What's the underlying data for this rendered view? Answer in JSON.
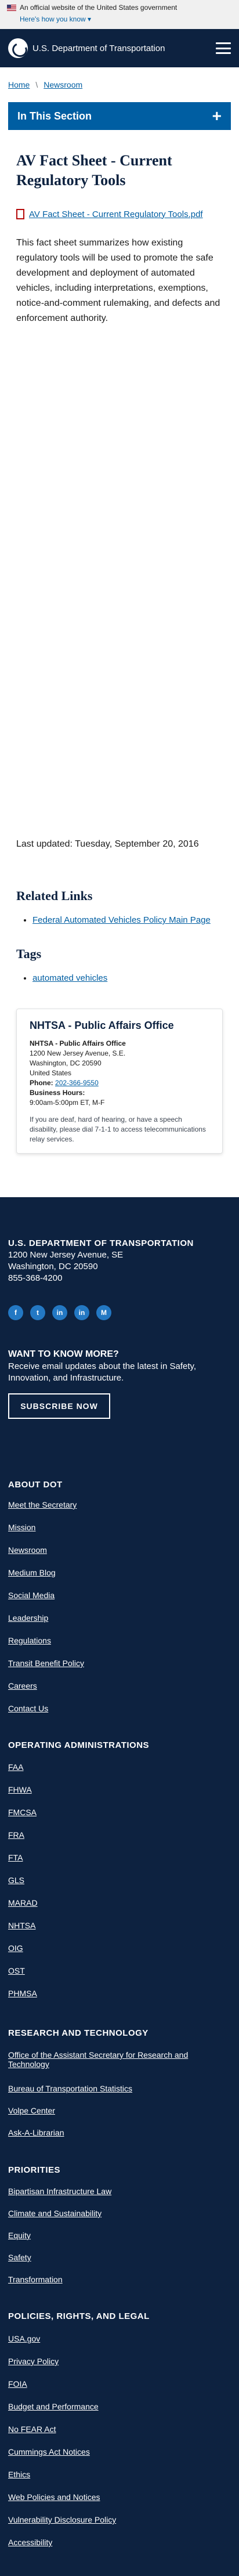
{
  "banner": {
    "text": "An official website of the United States government",
    "how_know": "Here's how you know"
  },
  "header": {
    "site_title": "U.S. Department of Transportation"
  },
  "breadcrumb": {
    "home": "Home",
    "newsroom": "Newsroom"
  },
  "section_nav": {
    "label": "In This Section"
  },
  "page": {
    "title": "AV Fact Sheet - Current Regulatory Tools",
    "file_link": "AV Fact Sheet - Current Regulatory Tools.pdf",
    "intro": "This fact sheet summarizes how existing regulatory tools will be used to promote the safe development and deployment of automated vehicles, including interpretations, exemptions, notice-and-comment rulemaking, and defects and enforcement authority.",
    "last_updated": "Last updated: Tuesday, September 20, 2016"
  },
  "related": {
    "title": "Related Links",
    "items": [
      "Federal Automated Vehicles Policy Main Page"
    ]
  },
  "tags": {
    "title": "Tags",
    "items": [
      "automated vehicles"
    ]
  },
  "contact": {
    "title": "NHTSA - Public Affairs Office",
    "org": "NHTSA - Public Affairs Office",
    "street": "1200 New Jersey Avenue, S.E.",
    "city": "Washington, DC 20590",
    "country": "United States",
    "phone_label": "Phone:",
    "phone": "202-366-9550",
    "hours_label": "Business Hours:",
    "hours": "9:00am-5:00pm ET, M-F",
    "note": "If you are deaf, hard of hearing, or have a speech disability, please dial 7-1-1 to access telecommunications relay services."
  },
  "footer": {
    "org": "U.S. DEPARTMENT OF TRANSPORTATION",
    "street": "1200 New Jersey Avenue, SE",
    "city": "Washington, DC 20590",
    "phone": "855-368-4200",
    "socials": [
      "f",
      "t",
      "in",
      "in",
      "M"
    ],
    "know_title": "WANT TO KNOW MORE?",
    "know_text": "Receive email updates about the latest in Safety, Innovation, and Infrastructure.",
    "subscribe": "SUBSCRIBE NOW",
    "sections": [
      {
        "title": "ABOUT DOT",
        "links": [
          "Meet the Secretary",
          "Mission",
          "Newsroom",
          "Medium Blog",
          "Social Media",
          "Leadership",
          "Regulations",
          "Transit Benefit Policy",
          "Careers",
          "Contact Us"
        ]
      },
      {
        "title": "OPERATING ADMINISTRATIONS",
        "links": [
          "FAA",
          "FHWA",
          "FMCSA",
          "FRA",
          "FTA",
          "GLS",
          "MARAD",
          "NHTSA",
          "OIG",
          "OST",
          "PHMSA"
        ]
      },
      {
        "title": "RESEARCH AND TECHNOLOGY",
        "links": [
          "Office of the Assistant Secretary for Research and Technology",
          "Bureau of Transportation Statistics",
          "Volpe Center",
          "Ask-A-Librarian"
        ]
      },
      {
        "title": "PRIORITIES",
        "links": [
          "Bipartisan Infrastructure Law",
          "Climate and Sustainability",
          "Equity",
          "Safety",
          "Transformation"
        ]
      },
      {
        "title": "POLICIES, RIGHTS, AND LEGAL",
        "links": [
          "USA.gov",
          "Privacy Policy",
          "FOIA",
          "Budget and Performance",
          "No FEAR Act",
          "Cummings Act Notices",
          "Ethics",
          "Web Policies and Notices",
          "Vulnerability Disclosure Policy",
          "Accessibility"
        ]
      }
    ]
  }
}
